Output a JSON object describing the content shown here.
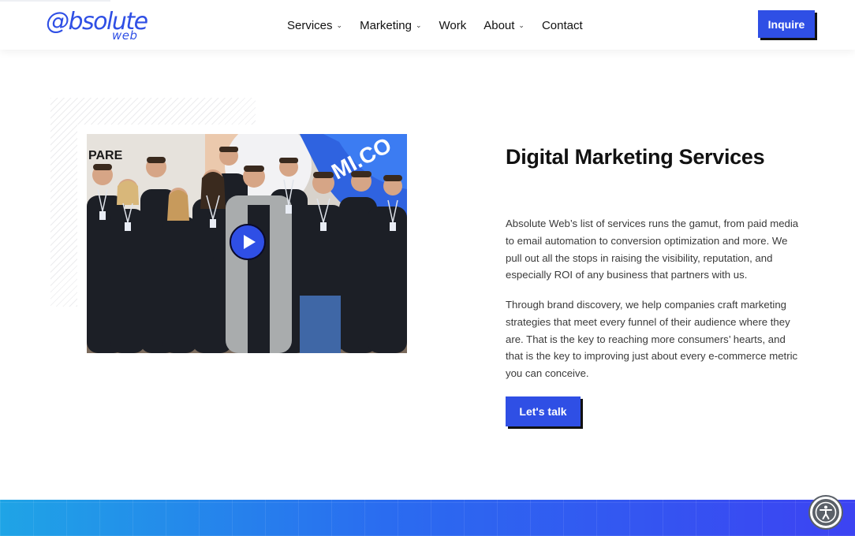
{
  "header": {
    "logo": {
      "main": "@bsolute",
      "sub": "web"
    },
    "nav": [
      {
        "label": "Services",
        "has_dropdown": true
      },
      {
        "label": "Marketing",
        "has_dropdown": true
      },
      {
        "label": "Work",
        "has_dropdown": false
      },
      {
        "label": "About",
        "has_dropdown": true
      },
      {
        "label": "Contact",
        "has_dropdown": false
      }
    ],
    "cta_label": "Inquire"
  },
  "media": {
    "play_icon": "play-icon",
    "backdrop_texts": [
      "PARE",
      "MI.CO"
    ]
  },
  "content": {
    "title": "Digital Marketing Services",
    "paragraph_1": "Absolute Web’s list of services runs the gamut, from paid media to email automation to conversion optimization and more. We pull out all the stops in raising the visibility, reputation, and especially ROI of any business that partners with us.",
    "paragraph_2": "Through brand discovery, we help companies craft marketing strategies that meet every funnel of their audience where they are. That is the key to reaching more consumers’ hearts, and that is the key to improving just about every e-commerce metric you can conceive.",
    "cta_label": "Let's talk"
  },
  "accessibility": {
    "icon": "accessibility-icon"
  },
  "colors": {
    "accent": "#2f4fe5",
    "text": "#111111",
    "body_text": "#3a3a3a",
    "banner_start": "#1fa4e6",
    "banner_end": "#3c43f2"
  }
}
